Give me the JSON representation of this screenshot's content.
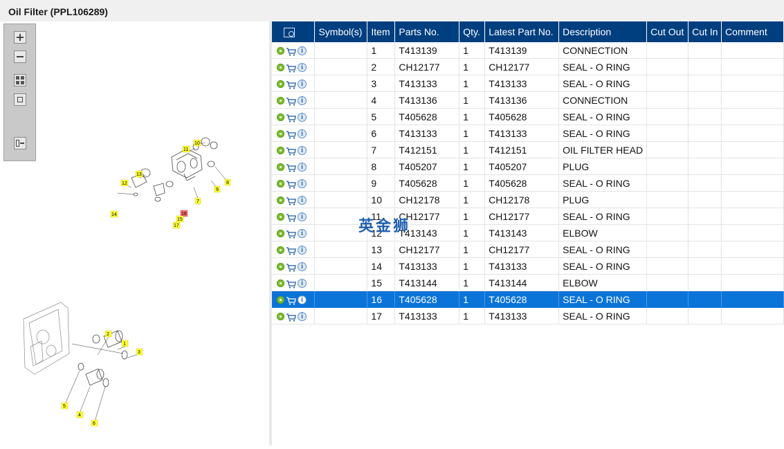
{
  "window": {
    "title": "Oil Filter (PPL106289)"
  },
  "toolbar": {
    "zoom_in": "zoom-in",
    "zoom_out": "zoom-out",
    "fit_grid": "fit-all",
    "fit_window": "fit-window",
    "export": "export"
  },
  "diagram": {
    "callouts_top": [
      "10",
      "11",
      "9",
      "8",
      "13",
      "12",
      "7",
      "16",
      "14",
      "15",
      "17"
    ],
    "callouts_bottom": [
      "2",
      "1",
      "3",
      "5",
      "4",
      "6"
    ],
    "highlighted": "16"
  },
  "table": {
    "columns": [
      "",
      "Symbol(s)",
      "Item",
      "Parts No.",
      "Qty.",
      "Latest Part No.",
      "Description",
      "Cut Out",
      "Cut In",
      "Comment"
    ],
    "rows": [
      {
        "item": "1",
        "part": "T413139",
        "qty": "1",
        "latest": "T413139",
        "desc": "CONNECTION"
      },
      {
        "item": "2",
        "part": "CH12177",
        "qty": "1",
        "latest": "CH12177",
        "desc": "SEAL - O RING"
      },
      {
        "item": "3",
        "part": "T413133",
        "qty": "1",
        "latest": "T413133",
        "desc": "SEAL - O RING"
      },
      {
        "item": "4",
        "part": "T413136",
        "qty": "1",
        "latest": "T413136",
        "desc": "CONNECTION"
      },
      {
        "item": "5",
        "part": "T405628",
        "qty": "1",
        "latest": "T405628",
        "desc": "SEAL - O RING"
      },
      {
        "item": "6",
        "part": "T413133",
        "qty": "1",
        "latest": "T413133",
        "desc": "SEAL - O RING"
      },
      {
        "item": "7",
        "part": "T412151",
        "qty": "1",
        "latest": "T412151",
        "desc": "OIL FILTER HEAD"
      },
      {
        "item": "8",
        "part": "T405207",
        "qty": "1",
        "latest": "T405207",
        "desc": "PLUG"
      },
      {
        "item": "9",
        "part": "T405628",
        "qty": "1",
        "latest": "T405628",
        "desc": "SEAL - O RING"
      },
      {
        "item": "10",
        "part": "CH12178",
        "qty": "1",
        "latest": "CH12178",
        "desc": "PLUG"
      },
      {
        "item": "11",
        "part": "CH12177",
        "qty": "1",
        "latest": "CH12177",
        "desc": "SEAL - O RING"
      },
      {
        "item": "12",
        "part": "T413143",
        "qty": "1",
        "latest": "T413143",
        "desc": "ELBOW"
      },
      {
        "item": "13",
        "part": "CH12177",
        "qty": "1",
        "latest": "CH12177",
        "desc": "SEAL - O RING"
      },
      {
        "item": "14",
        "part": "T413133",
        "qty": "1",
        "latest": "T413133",
        "desc": "SEAL - O RING"
      },
      {
        "item": "15",
        "part": "T413144",
        "qty": "1",
        "latest": "T413144",
        "desc": "ELBOW"
      },
      {
        "item": "16",
        "part": "T405628",
        "qty": "1",
        "latest": "T405628",
        "desc": "SEAL - O RING",
        "selected": true
      },
      {
        "item": "17",
        "part": "T413133",
        "qty": "1",
        "latest": "T413133",
        "desc": "SEAL - O RING"
      }
    ],
    "icons": [
      "gear-icon",
      "cart-icon",
      "info-icon"
    ],
    "selected_item": "16"
  },
  "watermark": "英金狮",
  "colors": {
    "header_bg": "#003f7f",
    "selected_row": "#0a74d9",
    "callout": "#ffff33",
    "callout_highlight": "#ff6b6b"
  }
}
